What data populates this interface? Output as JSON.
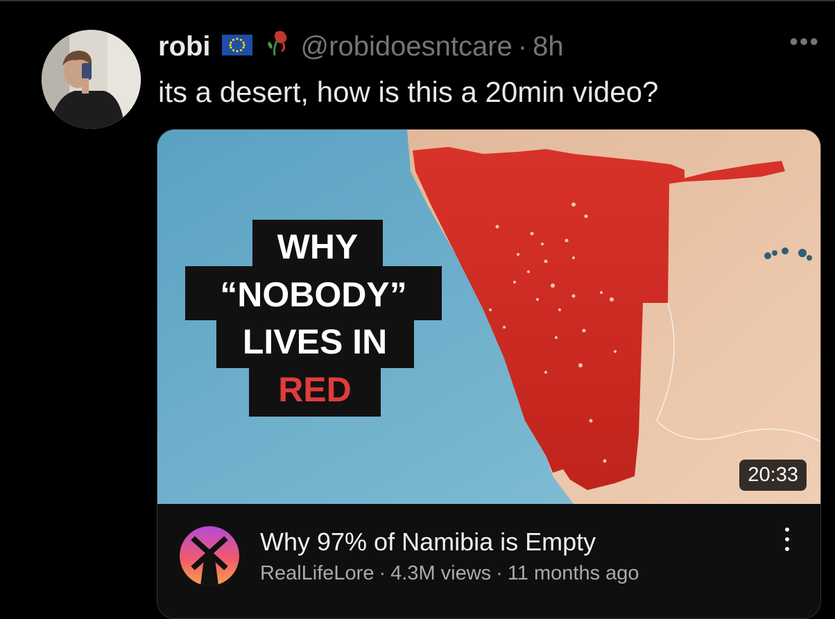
{
  "tweet": {
    "author_name": "robi",
    "handle": "@robidoesntcare",
    "separator": "·",
    "time": "8h",
    "text": "its a desert, how is this a 20min video?",
    "more_icon": "more-horizontal-icon"
  },
  "video": {
    "thumbnail_lines": [
      "WHY",
      "“NOBODY”",
      "LIVES IN",
      "RED"
    ],
    "duration": "20:33",
    "title": "Why 97% of Namibia is Empty",
    "channel": "RealLifeLore",
    "meta_separator": "·",
    "views": "4.3M views",
    "age": "11 months ago",
    "more_icon": "more-vertical-icon"
  },
  "colors": {
    "background": "#000000",
    "text_primary": "#e7e9ea",
    "text_secondary": "#71767b",
    "map_red": "#d92b22",
    "ocean": "#6aa8c4",
    "land": "#e9c2a3"
  }
}
